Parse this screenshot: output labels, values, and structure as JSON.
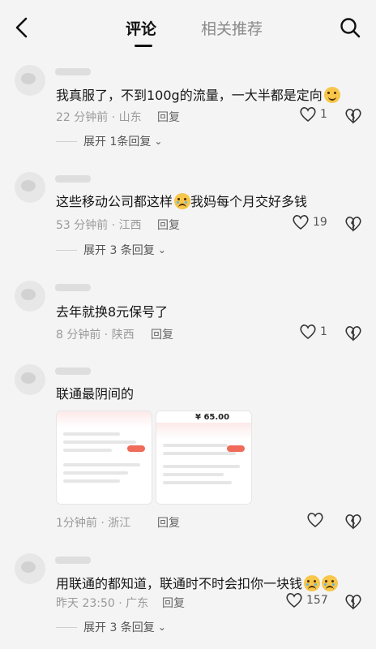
{
  "header": {
    "tabs": [
      "评论",
      "相关推荐"
    ]
  },
  "comments": [
    {
      "text": "我真服了，不到100g的流量，一大半都是定向",
      "emoji": "grin-sweat",
      "time": "22 分钟前 · 山东",
      "reply": "回复",
      "likes": "1",
      "expand": "展开 1条回复"
    },
    {
      "text_a": "这些移动公司都这样",
      "text_b": "我妈每个月交好多钱",
      "emoji": "crying",
      "time": "53 分钟前 · 江西",
      "reply": "回复",
      "likes": "19",
      "expand": "展开 3 条回复"
    },
    {
      "text": "去年就换8元保号了",
      "time": "8 分钟前 · 陕西",
      "reply": "回复",
      "likes": "1"
    },
    {
      "text": "联通最阴间的",
      "time": "1分钟前 · 浙江",
      "reply": "回复",
      "likes": "",
      "images": [
        {
          "price_label": "¥ 65.00"
        },
        {
          "price_label": ""
        }
      ]
    },
    {
      "text": "用联通的都知道，联通时不时会扣你一块钱",
      "emoji": "crying",
      "time": "昨天 23:50 · 广东",
      "reply": "回复",
      "likes": "157",
      "expand": "展开 3 条回复"
    }
  ],
  "colors": {
    "background": "#f4f4f4",
    "meta": "#9a9a9a",
    "emoji": "#f7c64a",
    "accent": "#f06b5a"
  }
}
